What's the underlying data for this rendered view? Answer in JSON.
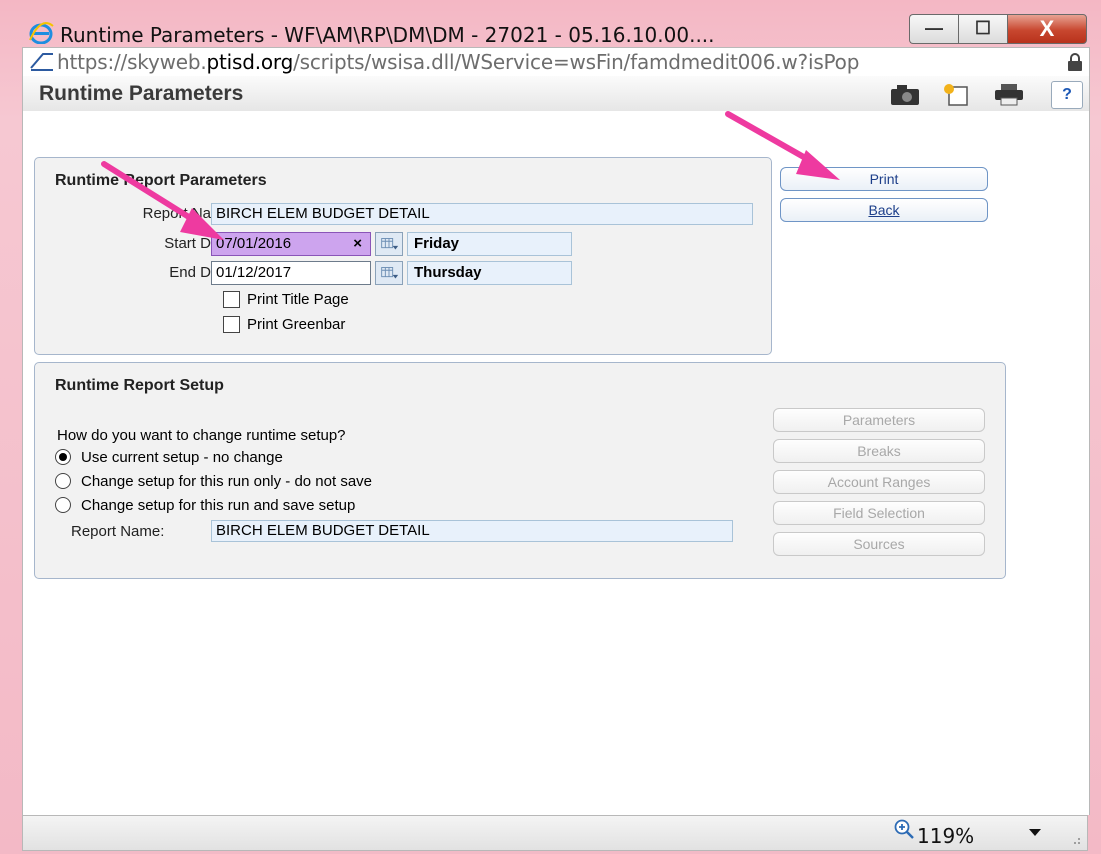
{
  "window": {
    "title": "Runtime Parameters - WF\\AM\\RP\\DM\\DM - 27021 - 05.16.10.00....",
    "minimize_glyph": "—",
    "maximize_glyph": "☐",
    "close_glyph": "X"
  },
  "address": {
    "url_prefix": "https://skyweb.",
    "url_domain": "ptisd.org",
    "url_suffix": "/scripts/wsisa.dll/WService=wsFin/famdmedit006.w?isPop"
  },
  "header": {
    "title": "Runtime Parameters",
    "help_label": "?"
  },
  "report_params": {
    "section_title": "Runtime Report Parameters",
    "report_name_label": "Report Name:",
    "report_name_value": "BIRCH ELEM BUDGET DETAIL",
    "start_date_label": "Start Date:",
    "start_date_value": "07/01/2016",
    "start_date_clear": "×",
    "start_day": "Friday",
    "end_date_label": "End Date:",
    "end_date_value": "01/12/2017",
    "end_day": "Thursday",
    "print_title_page_label": "Print Title Page",
    "print_greenbar_label": "Print Greenbar"
  },
  "actions": {
    "print_label": "Print",
    "back_label": "Back"
  },
  "report_setup": {
    "section_title": "Runtime Report Setup",
    "question": "How do you want to change runtime setup?",
    "options": [
      {
        "label": "Use current setup - no change",
        "selected": true
      },
      {
        "label": "Change setup for this run only - do not save",
        "selected": false
      },
      {
        "label": "Change setup for this run and save setup",
        "selected": false
      }
    ],
    "report_name_label": "Report Name:",
    "report_name_value": "BIRCH ELEM BUDGET DETAIL",
    "buttons": [
      "Parameters",
      "Breaks",
      "Account Ranges",
      "Field Selection",
      "Sources"
    ]
  },
  "status": {
    "zoom": "119%"
  },
  "colors": {
    "window_frame": "#f4b7c4",
    "active_field": "#cda4ee",
    "annotation_arrow": "#ee3aa0"
  }
}
